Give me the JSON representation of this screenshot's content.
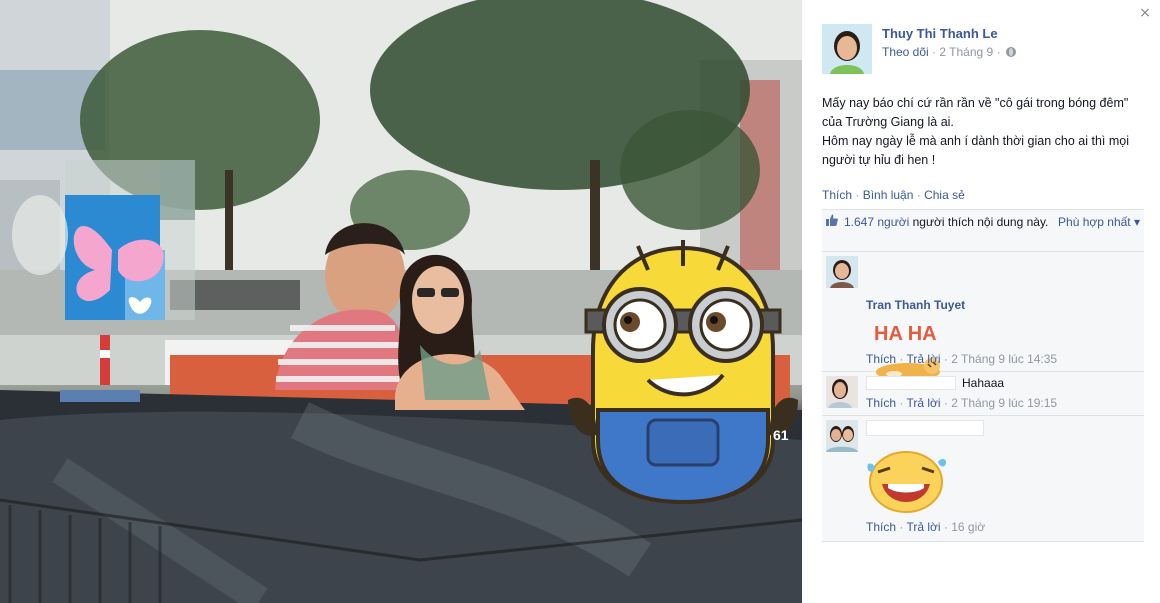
{
  "photo": {
    "minion_label": "61"
  },
  "panel": {
    "close_label": "×",
    "author": {
      "name": "Thuy Thi Thanh Le",
      "follow": "Theo dõi",
      "sep": "·",
      "date": "2 Tháng 9",
      "privacy_icon": "globe-icon"
    },
    "post": {
      "lines": [
        "Mấy nay báo chí cứ rần rần về \"cô gái trong bóng đêm\" của Trường Giang là ai.",
        "Hôm nay ngày lễ mà anh í dành thời gian cho ai thì mọi người tự hỉu đi hen !"
      ]
    },
    "actions": {
      "like": "Thích",
      "comment": "Bình luận",
      "share": "Chia sẻ",
      "sep": " · "
    },
    "likes": {
      "count": "1.647 người",
      "text": " người thích nội dung này.",
      "sort": "Phù hợp nhất ▾",
      "icon": "thumbs-up-icon"
    },
    "comments": [
      {
        "name": "Tran Thanh Tuyet",
        "text": "",
        "sticker": "haha-sticker",
        "sticker_text": "HA HA",
        "like": "Thích",
        "reply": "Trả lời",
        "time": "2 Tháng 9 lúc 14:35"
      },
      {
        "name": "",
        "text": "Hahaaa",
        "like": "Thích",
        "reply": "Trả lời",
        "time": "2 Tháng 9 lúc 19:15"
      },
      {
        "name": "",
        "text": "",
        "sticker": "laughing-face-sticker",
        "like": "Thích",
        "reply": "Trả lời",
        "time": "16 giờ"
      }
    ],
    "dot": " · "
  },
  "colors": {
    "link": "#3b5998",
    "meta": "#9197a3",
    "ufi_bg": "#f6f7f9"
  }
}
